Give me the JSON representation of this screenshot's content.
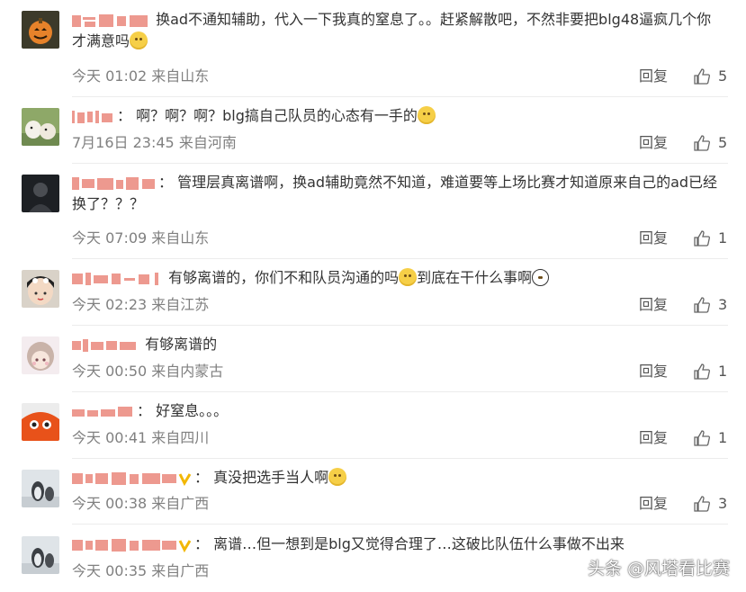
{
  "reply_label": "回复",
  "colon": "：",
  "comments": [
    {
      "text": "换ad不通知辅助，代入一下我真的窒息了。。赶紧解散吧，不然非要把blg48逼疯几个你才满意吗",
      "time": "今天 01:02",
      "location": "来自山东",
      "likes": "5",
      "avatar_icon": "pumpkin-avatar-icon"
    },
    {
      "text": "啊？啊？啊？blg搞自己队员的心态有一手的",
      "time": "7月16日 23:45",
      "location": "来自河南",
      "likes": "5",
      "avatar_icon": "dogs-avatar-icon"
    },
    {
      "text": "管理层真离谱啊，换ad辅助竟然不知道，难道要等上场比赛才知道原来自己的ad已经换了？？？",
      "time": "今天 07:09",
      "location": "来自山东",
      "likes": "1",
      "avatar_icon": "dark-portrait-avatar-icon"
    },
    {
      "text_a": "有够离谱的，你们不和队员沟通的吗",
      "text_b": "到底在干什么事啊",
      "time": "今天 02:23",
      "location": "来自江苏",
      "likes": "3",
      "avatar_icon": "penguin-hat-avatar-icon"
    },
    {
      "text": "有够离谱的",
      "time": "今天 00:50",
      "location": "来自内蒙古",
      "likes": "1",
      "avatar_icon": "anime-girl-avatar-icon"
    },
    {
      "text": "好窒息。。。",
      "time": "今天 00:41",
      "location": "来自四川",
      "likes": "1",
      "avatar_icon": "orange-creature-avatar-icon"
    },
    {
      "text": "真没把选手当人啊",
      "time": "今天 00:38",
      "location": "来自广西",
      "likes": "3",
      "avatar_icon": "penguin-avatar-icon"
    },
    {
      "text": "离谱…但一想到是blg又觉得合理了…这破比队伍什么事做不出来",
      "time": "今天 00:35",
      "location": "来自广西",
      "likes": "",
      "avatar_icon": "penguin-avatar-icon"
    }
  ],
  "watermark": "头条 @风塔看比赛",
  "colors": {
    "meta": "#808080",
    "divider": "#ececec",
    "username_blur": "#e8786a"
  }
}
